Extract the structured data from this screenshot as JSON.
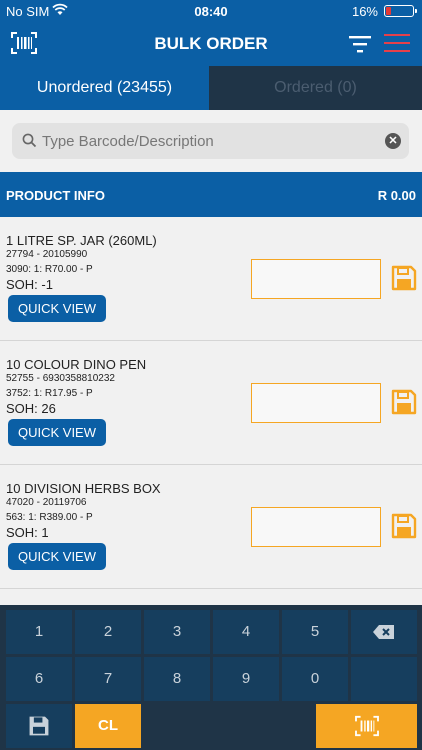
{
  "status_bar": {
    "carrier": "No SIM",
    "time": "08:40",
    "battery": "16%"
  },
  "header": {
    "title": "BULK ORDER"
  },
  "tabs": [
    {
      "label": "Unordered (23455)"
    },
    {
      "label": "Ordered (0)"
    }
  ],
  "search": {
    "placeholder": "Type Barcode/Description",
    "value": ""
  },
  "info_bar": {
    "label": "PRODUCT INFO",
    "total": "R 0.00"
  },
  "products": [
    {
      "name": "1 LITRE SP. JAR (260ML)",
      "code": "27794 - 20105990",
      "price": "3090: 1: R70.00 - P",
      "soh": "SOH: -1",
      "quick_view": "QUICK VIEW"
    },
    {
      "name": "10 COLOUR DINO PEN",
      "code": "52755 - 6930358810232",
      "price": "3752: 1: R17.95 - P",
      "soh": "SOH: 26",
      "quick_view": "QUICK VIEW"
    },
    {
      "name": "10 DIVISION HERBS BOX",
      "code": "47020 - 20119706",
      "price": "563: 1: R389.00 - P",
      "soh": "SOH: 1",
      "quick_view": "QUICK VIEW"
    }
  ],
  "keypad": {
    "row1": [
      "1",
      "2",
      "3",
      "4",
      "5"
    ],
    "row2": [
      "6",
      "7",
      "8",
      "9",
      "0"
    ],
    "clear": "CL"
  },
  "colors": {
    "primary": "#0b5fa5",
    "dark": "#1f3447",
    "accent": "#f5a623",
    "menu": "#e5404a"
  }
}
